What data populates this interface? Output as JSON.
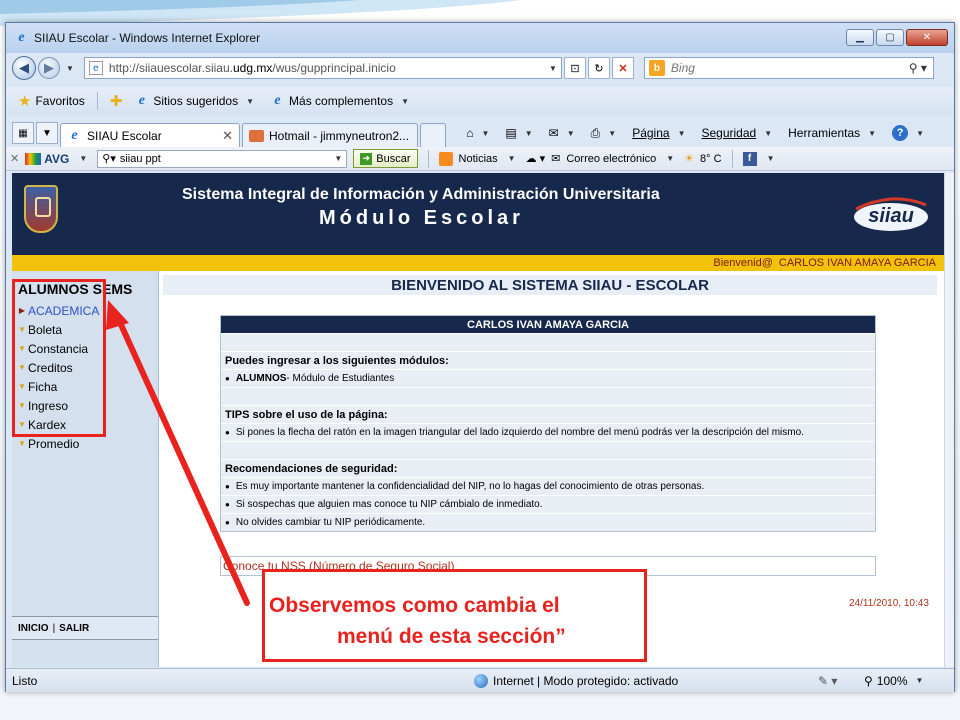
{
  "window": {
    "title": "SIIAU Escolar - Windows Internet Explorer",
    "controls": {
      "minimize": "▁",
      "maximize": "▢",
      "close": "✕"
    }
  },
  "address": {
    "url_prefix": "http://siiauescolar.siiau.",
    "url_domain": "udg.mx",
    "url_suffix": "/wus/gupprincipal.inicio",
    "search_placeholder": "Bing"
  },
  "favorites_bar": {
    "favorites": "Favoritos",
    "suggested": "Sitios sugeridos",
    "addons": "Más complementos"
  },
  "tabs": [
    {
      "label": "SIIAU Escolar",
      "active": true
    },
    {
      "label": "Hotmail - jimmyneutron2...",
      "active": false
    }
  ],
  "command_bar": {
    "page": "Página",
    "safety": "Seguridad",
    "tools": "Herramientas",
    "help": "?"
  },
  "avg_toolbar": {
    "brand": "AVG",
    "search_value": "siiau ppt",
    "search_button": "Buscar",
    "news": "Noticias",
    "email": "Correo electrónico",
    "weather": "8° C"
  },
  "site": {
    "system_title": "Sistema Integral de Información y Administración Universitaria",
    "module_title": "Módulo Escolar",
    "logo_text": "siiau",
    "welcome_prefix": "Bienvenid@",
    "user_name": "CARLOS IVAN AMAYA GARCIA",
    "left_header": "ALUMNOS SEMS",
    "menu": [
      {
        "label": "ACADEMICA"
      },
      {
        "label": "Boleta"
      },
      {
        "label": "Constancia"
      },
      {
        "label": "Creditos"
      },
      {
        "label": "Ficha"
      },
      {
        "label": "Ingreso"
      },
      {
        "label": "Kardex"
      },
      {
        "label": "Promedio"
      }
    ],
    "footer_links": {
      "home": "INICIO",
      "sep": "|",
      "logout": "SALIR"
    },
    "welcome_banner": "BIENVENIDO AL SISTEMA SIIAU - ESCOLAR",
    "info": {
      "header": "CARLOS IVAN AMAYA GARCIA",
      "modules_title": "Puedes ingresar a los siguientes módulos:",
      "module_name": "ALUMNOS",
      "module_desc": " - Módulo de Estudiantes",
      "tips_title": "TIPS sobre el uso de la página:",
      "tip_1": "Si pones la flecha del ratón en la imagen triangular del lado izquierdo del nombre del menú podrás ver la descripción del mismo.",
      "security_title": "Recomendaciones de seguridad:",
      "sec_1": "Es muy importante mantener la confidencialidad del NIP, no lo hagas del conocimiento de otras personas.",
      "sec_2": "Si sospechas que alguien mas conoce tu NIP cámbialo de inmediato.",
      "sec_3": "No olvides cambiar tu NIP periódicamente."
    },
    "nss_link": "Conoce tu NSS (Número de Seguro Social)",
    "datetime": "24/11/2010, 10:43"
  },
  "annotation": {
    "line1": "Observemos como cambia el",
    "line2": "menú de esta sección”",
    "color": "#e8221d"
  },
  "statusbar": {
    "status": "Listo",
    "zone": "Internet | Modo protegido: activado",
    "zoom": "100%"
  }
}
